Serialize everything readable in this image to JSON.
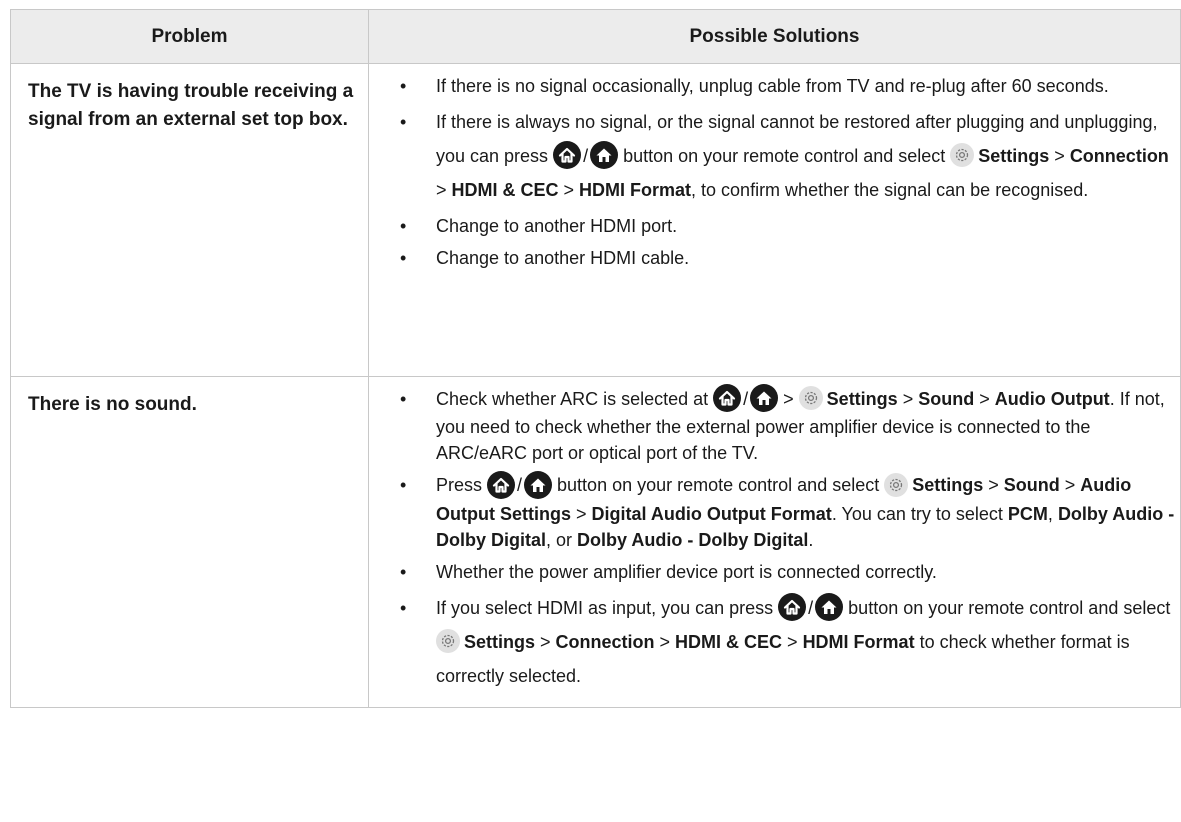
{
  "header": {
    "problem": "Problem",
    "solutions": "Possible Solutions"
  },
  "rows": [
    {
      "problem": "The TV is having trouble receiving a signal from an external set top box.",
      "s1": "If there is no signal occasionally, unplug cable from TV and re-plug after 60 seconds.",
      "s2a": "If there is always no signal, or the signal cannot be restored after plugging and unplugging, you can press ",
      "s2b": " button on your remote control and select ",
      "s2settings": "Settings",
      "s2c": " > ",
      "s2connection": "Connection",
      "s2d": " > ",
      "s2hdmicec": "HDMI & CEC",
      "s2e": " > ",
      "s2format": "HDMI Format",
      "s2f": ", to confirm whether the signal can be recognised.",
      "s3": "Change to another HDMI port.",
      "s4": "Change to another HDMI cable."
    },
    {
      "problem": "There is no sound.",
      "s1a": "Check whether ARC is selected at ",
      "s1b": " > ",
      "s1settings": "Settings",
      "s1c": " > ",
      "s1sound": "Sound",
      "s1d": " > ",
      "s1audio": "Audio Output",
      "s1e": ". If not, you need to check whether the external power amplifier device is connected to the ARC/eARC port or optical port of the TV.",
      "s2a": "Press ",
      "s2b": " button on your remote control and select ",
      "s2settings": "Settings",
      "s2c": " > ",
      "s2sound": "Sound",
      "s2d": " > ",
      "s2aos": "Audio Output Settings",
      "s2e": " > ",
      "s2daof": "Digital Audio Output Format",
      "s2f": ". You can try to select ",
      "s2pcm": "PCM",
      "s2g": ", ",
      "s2dd1": "Dolby Audio - Dolby Digital",
      "s2h": ", or ",
      "s2dd2": "Dolby Audio - Dolby Digital",
      "s2i": ".",
      "s3": "Whether the power amplifier device port is connected correctly.",
      "s4a": "If you select HDMI as input, you can press ",
      "s4b": " button on your remote control and select ",
      "s4settings": "Settings",
      "s4c": " > ",
      "s4connection": "Connection",
      "s4d": " > ",
      "s4hdmicec": "HDMI & CEC",
      "s4e": " > ",
      "s4format": "HDMI Format",
      "s4f": " to check whether format is correctly selected."
    }
  ],
  "bullet": "•",
  "slash": "/",
  "icons": {
    "home": "home-icon",
    "home_alt": "home-alt-icon",
    "gear": "gear-icon"
  },
  "colors": {
    "header_bg": "#ececec",
    "border": "#c8c8c8",
    "icon_dark": "#1a1a1a",
    "gear_bg": "#e0e0e0"
  }
}
